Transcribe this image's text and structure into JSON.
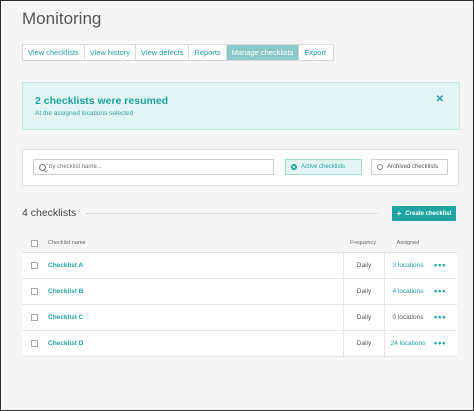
{
  "page": {
    "title": "Monitoring"
  },
  "tabs": [
    {
      "label": "View checklists",
      "active": false
    },
    {
      "label": "View history",
      "active": false
    },
    {
      "label": "View defects",
      "active": false
    },
    {
      "label": "Reports",
      "active": false
    },
    {
      "label": "Manage checklists",
      "active": true
    },
    {
      "label": "Export",
      "active": false
    }
  ],
  "alert": {
    "title": "2 checklists were resumed",
    "subtitle": "At the assigned locations selected",
    "close_icon": "close-icon"
  },
  "filters": {
    "search_placeholder": "by checklist name...",
    "search_value": "",
    "active_label": "Active checklists",
    "archived_label": "Archived checklists",
    "selected": "active"
  },
  "summary": {
    "count_label": "4 checklists"
  },
  "create_button": {
    "icon": "plus-icon",
    "label": "Create checklist"
  },
  "table": {
    "columns": {
      "name": "Checklist name",
      "frequency": "Frequency",
      "assigned": "Assigned"
    },
    "rows": [
      {
        "name": "Checklist A",
        "frequency": "Daily",
        "assigned": "3 locations",
        "more": "•••"
      },
      {
        "name": "Checklist B",
        "frequency": "Daily",
        "assigned": "4 locations",
        "more": "•••"
      },
      {
        "name": "Checklist C",
        "frequency": "Daily",
        "assigned": "0 locations",
        "more": "•••"
      },
      {
        "name": "Checklist D",
        "frequency": "Daily",
        "assigned": "24 locations",
        "more": "•••"
      }
    ]
  },
  "colors": {
    "accent": "#1fa3a3",
    "alert_bg": "#e2f5f1",
    "tab_active": "#8bc9c9"
  }
}
